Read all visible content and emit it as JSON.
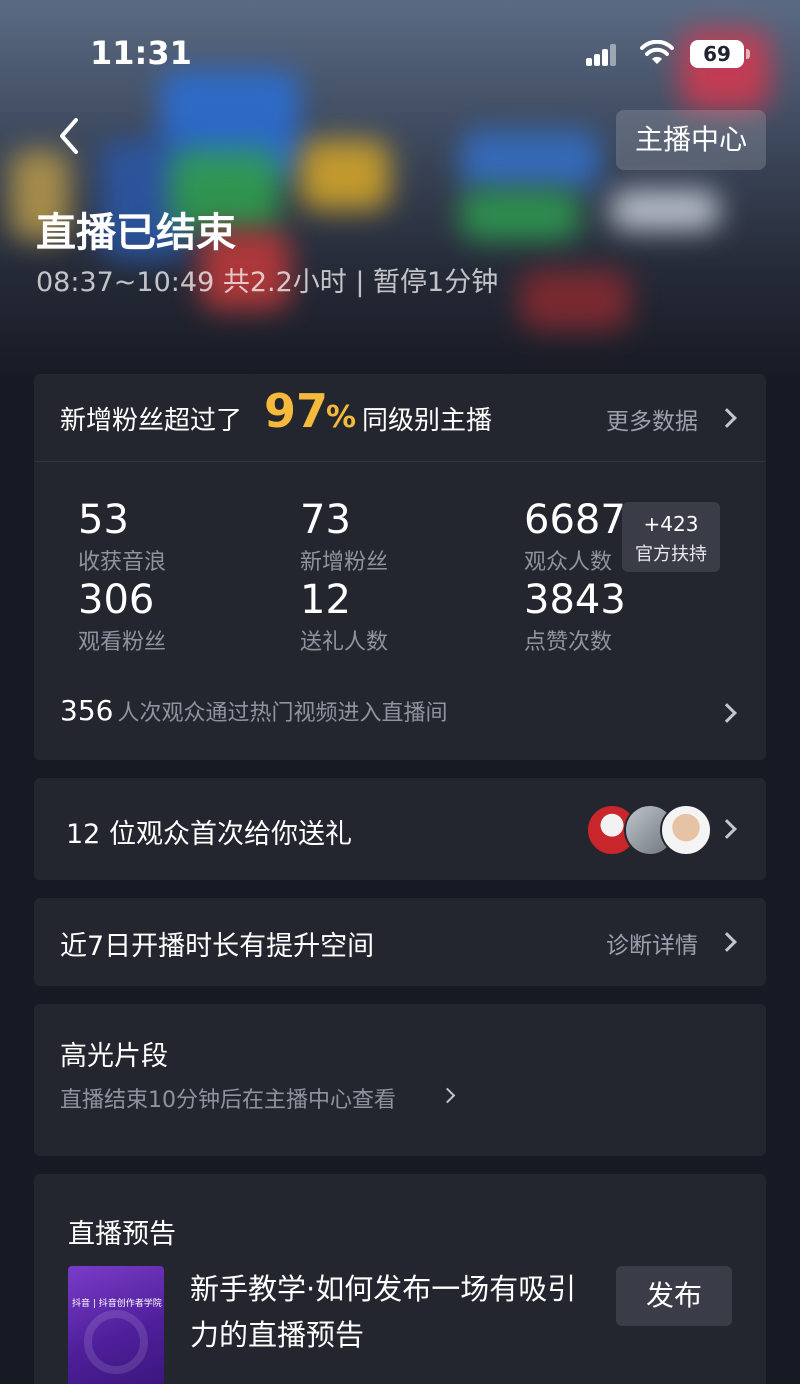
{
  "status_bar": {
    "time": "11:31",
    "battery": "69",
    "icons": [
      "cellular-signal-icon",
      "wifi-icon",
      "battery-icon"
    ]
  },
  "header": {
    "back_icon": "chevron-left-icon",
    "anchor_center_label": "主播中心",
    "title": "直播已结束",
    "subtitle": "08:37~10:49 共2.2小时 | 暂停1分钟"
  },
  "stats_card": {
    "prefix": "新增粉丝超过了",
    "percent": "97",
    "percent_symbol": "%",
    "suffix": "同级别主播",
    "more_label": "更多数据",
    "stats": [
      {
        "value": "53",
        "label": "收获音浪"
      },
      {
        "value": "73",
        "label": "新增粉丝"
      },
      {
        "value": "6687",
        "label": "观众人数"
      },
      {
        "value": "306",
        "label": "观看粉丝"
      },
      {
        "value": "12",
        "label": "送礼人数"
      },
      {
        "value": "3843",
        "label": "点赞次数"
      }
    ],
    "boost": {
      "value": "+423",
      "label": "官方扶持"
    },
    "hot_count": "356",
    "hot_text": "人次观众通过热门视频进入直播间"
  },
  "gift_card": {
    "text": "12 位观众首次给你送礼",
    "avatars": [
      "avatar-1",
      "avatar-2",
      "avatar-3"
    ]
  },
  "duration_card": {
    "text": "近7日开播时长有提升空间",
    "diagnose_label": "诊断详情"
  },
  "highlight_card": {
    "title": "高光片段",
    "subtitle": "直播结束10分钟后在主播中心查看"
  },
  "preview_card": {
    "title": "直播预告",
    "thumb_tag": "抖音 | 抖音创作者学院",
    "description": "新手教学·如何发布一场有吸引力的直播预告",
    "publish_label": "发布"
  },
  "colors": {
    "accent": "#f5b93c",
    "card_bg": "#24262f",
    "page_bg": "#171a24"
  }
}
